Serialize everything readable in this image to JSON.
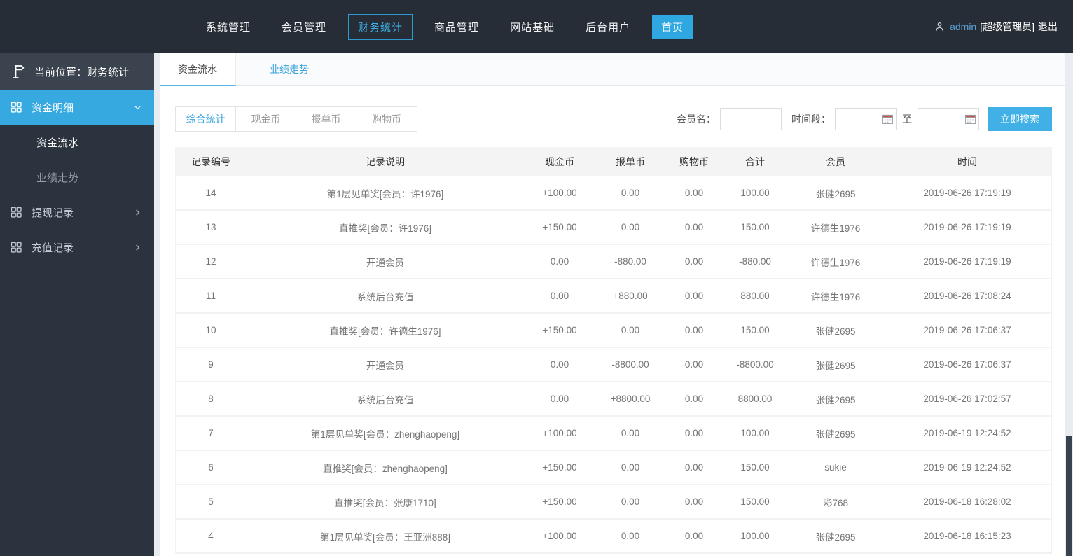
{
  "topbar": {
    "nav": [
      "系统管理",
      "会员管理",
      "财务统计",
      "商品管理",
      "网站基础",
      "后台用户",
      "首页"
    ],
    "user": {
      "name": "admin",
      "role": "[超级管理员]",
      "logout": "退出"
    }
  },
  "sidebar": {
    "location": "当前位置：财务统计",
    "menu_funds_detail": "资金明细",
    "sub_fund_flow": "资金流水",
    "sub_performance_trend": "业绩走势",
    "menu_withdraw_records": "提现记录",
    "menu_recharge_records": "充值记录"
  },
  "tabs": {
    "fund_flow": "资金流水",
    "performance_trend": "业绩走势"
  },
  "filters": {
    "all": "综合统计",
    "cash_coin": "现金币",
    "order_coin": "报单币",
    "shopping_coin": "购物币"
  },
  "search": {
    "member_label": "会员名：",
    "member_value": "",
    "time_label": "时间段：",
    "date_from_value": "",
    "to": "至",
    "date_to_value": "",
    "button": "立即搜索"
  },
  "table": {
    "headers": [
      "记录编号",
      "记录说明",
      "现金币",
      "报单币",
      "购物币",
      "合计",
      "会员",
      "时间"
    ],
    "rows": [
      [
        "14",
        "第1层见单奖[会员：许1976]",
        "+100.00",
        "0.00",
        "0.00",
        "100.00",
        "张健2695",
        "2019-06-26 17:19:19"
      ],
      [
        "13",
        "直推奖[会员：许1976]",
        "+150.00",
        "0.00",
        "0.00",
        "150.00",
        "许德生1976",
        "2019-06-26 17:19:19"
      ],
      [
        "12",
        "开通会员",
        "0.00",
        "-880.00",
        "0.00",
        "-880.00",
        "许德生1976",
        "2019-06-26 17:19:19"
      ],
      [
        "11",
        "系统后台充值",
        "0.00",
        "+880.00",
        "0.00",
        "880.00",
        "许德生1976",
        "2019-06-26 17:08:24"
      ],
      [
        "10",
        "直推奖[会员：许德生1976]",
        "+150.00",
        "0.00",
        "0.00",
        "150.00",
        "张健2695",
        "2019-06-26 17:06:37"
      ],
      [
        "9",
        "开通会员",
        "0.00",
        "-8800.00",
        "0.00",
        "-8800.00",
        "张健2695",
        "2019-06-26 17:06:37"
      ],
      [
        "8",
        "系统后台充值",
        "0.00",
        "+8800.00",
        "0.00",
        "8800.00",
        "张健2695",
        "2019-06-26 17:02:57"
      ],
      [
        "7",
        "第1层见单奖[会员：zhenghaopeng]",
        "+100.00",
        "0.00",
        "0.00",
        "100.00",
        "张健2695",
        "2019-06-19 12:24:52"
      ],
      [
        "6",
        "直推奖[会员：zhenghaopeng]",
        "+150.00",
        "0.00",
        "0.00",
        "150.00",
        "sukie",
        "2019-06-19 12:24:52"
      ],
      [
        "5",
        "直推奖[会员：张康1710]",
        "+150.00",
        "0.00",
        "0.00",
        "150.00",
        "彩768",
        "2019-06-18 16:28:02"
      ],
      [
        "4",
        "第1层见单奖[会员：王亚洲888]",
        "+100.00",
        "0.00",
        "0.00",
        "100.00",
        "张健2695",
        "2019-06-18 16:15:23"
      ]
    ]
  },
  "colors": {
    "topbar_bg": "#262d36",
    "sidebar_bg": "#2b333e",
    "accent_blue": "#36a9e1",
    "link_blue": "#3aa4df",
    "button_blue": "#41b0e6"
  }
}
